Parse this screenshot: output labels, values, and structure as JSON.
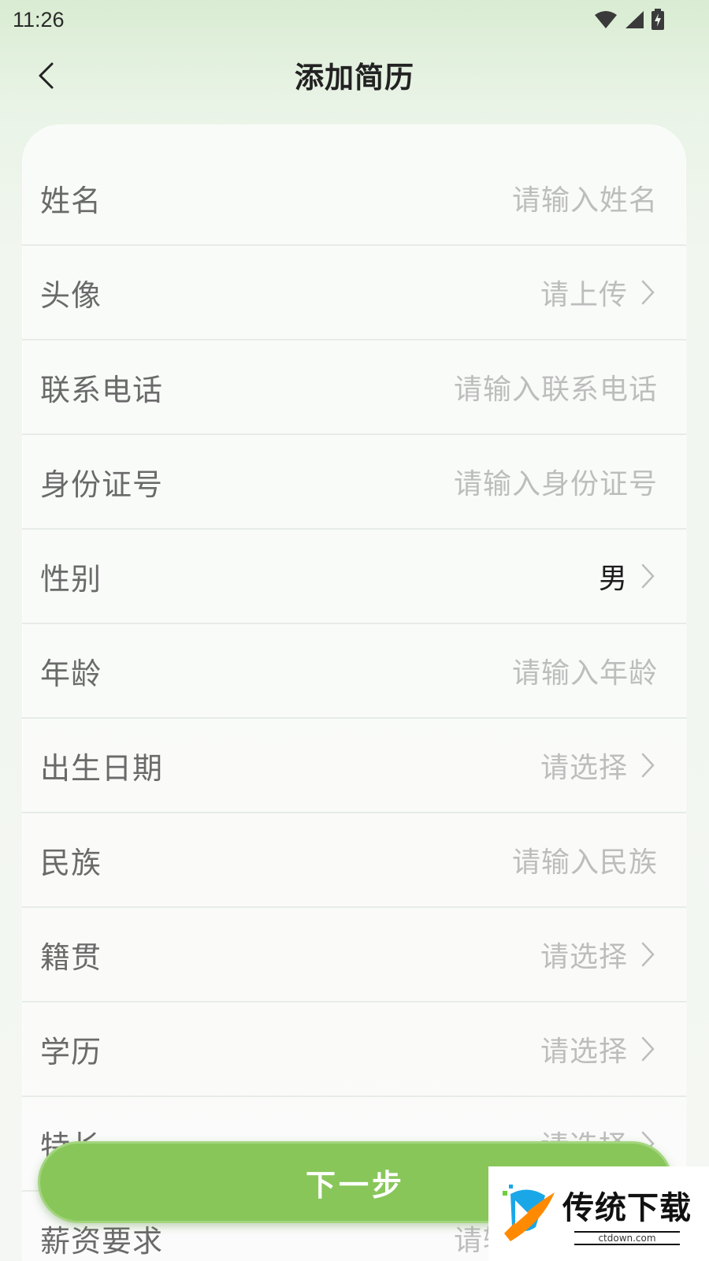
{
  "status_bar": {
    "time": "11:26",
    "icons": [
      "wifi-icon",
      "signal-icon",
      "battery-charging-icon"
    ]
  },
  "header": {
    "title": "添加简历",
    "back_icon": "chevron-left-icon"
  },
  "form": {
    "rows": [
      {
        "label": "姓名",
        "value": "请输入姓名",
        "filled": false,
        "chevron": false
      },
      {
        "label": "头像",
        "value": "请上传",
        "filled": false,
        "chevron": true
      },
      {
        "label": "联系电话",
        "value": "请输入联系电话",
        "filled": false,
        "chevron": false
      },
      {
        "label": "身份证号",
        "value": "请输入身份证号",
        "filled": false,
        "chevron": false
      },
      {
        "label": "性别",
        "value": "男",
        "filled": true,
        "chevron": true
      },
      {
        "label": "年龄",
        "value": "请输入年龄",
        "filled": false,
        "chevron": false
      },
      {
        "label": "出生日期",
        "value": "请选择",
        "filled": false,
        "chevron": true
      },
      {
        "label": "民族",
        "value": "请输入民族",
        "filled": false,
        "chevron": false
      },
      {
        "label": "籍贯",
        "value": "请选择",
        "filled": false,
        "chevron": true
      },
      {
        "label": "学历",
        "value": "请选择",
        "filled": false,
        "chevron": true
      },
      {
        "label": "特长",
        "value": "请选择",
        "filled": false,
        "chevron": true
      },
      {
        "label": "薪资要求",
        "value": "请输入薪资要求",
        "filled": false,
        "chevron": false
      }
    ]
  },
  "footer": {
    "next_label": "下一步"
  },
  "watermark": {
    "title": "传统下载",
    "subtitle": "ctdown.com"
  },
  "colors": {
    "accent": "#88c65a",
    "label": "#6a6a6a",
    "placeholder": "#bdbdbd",
    "value": "#1c1c1c"
  }
}
